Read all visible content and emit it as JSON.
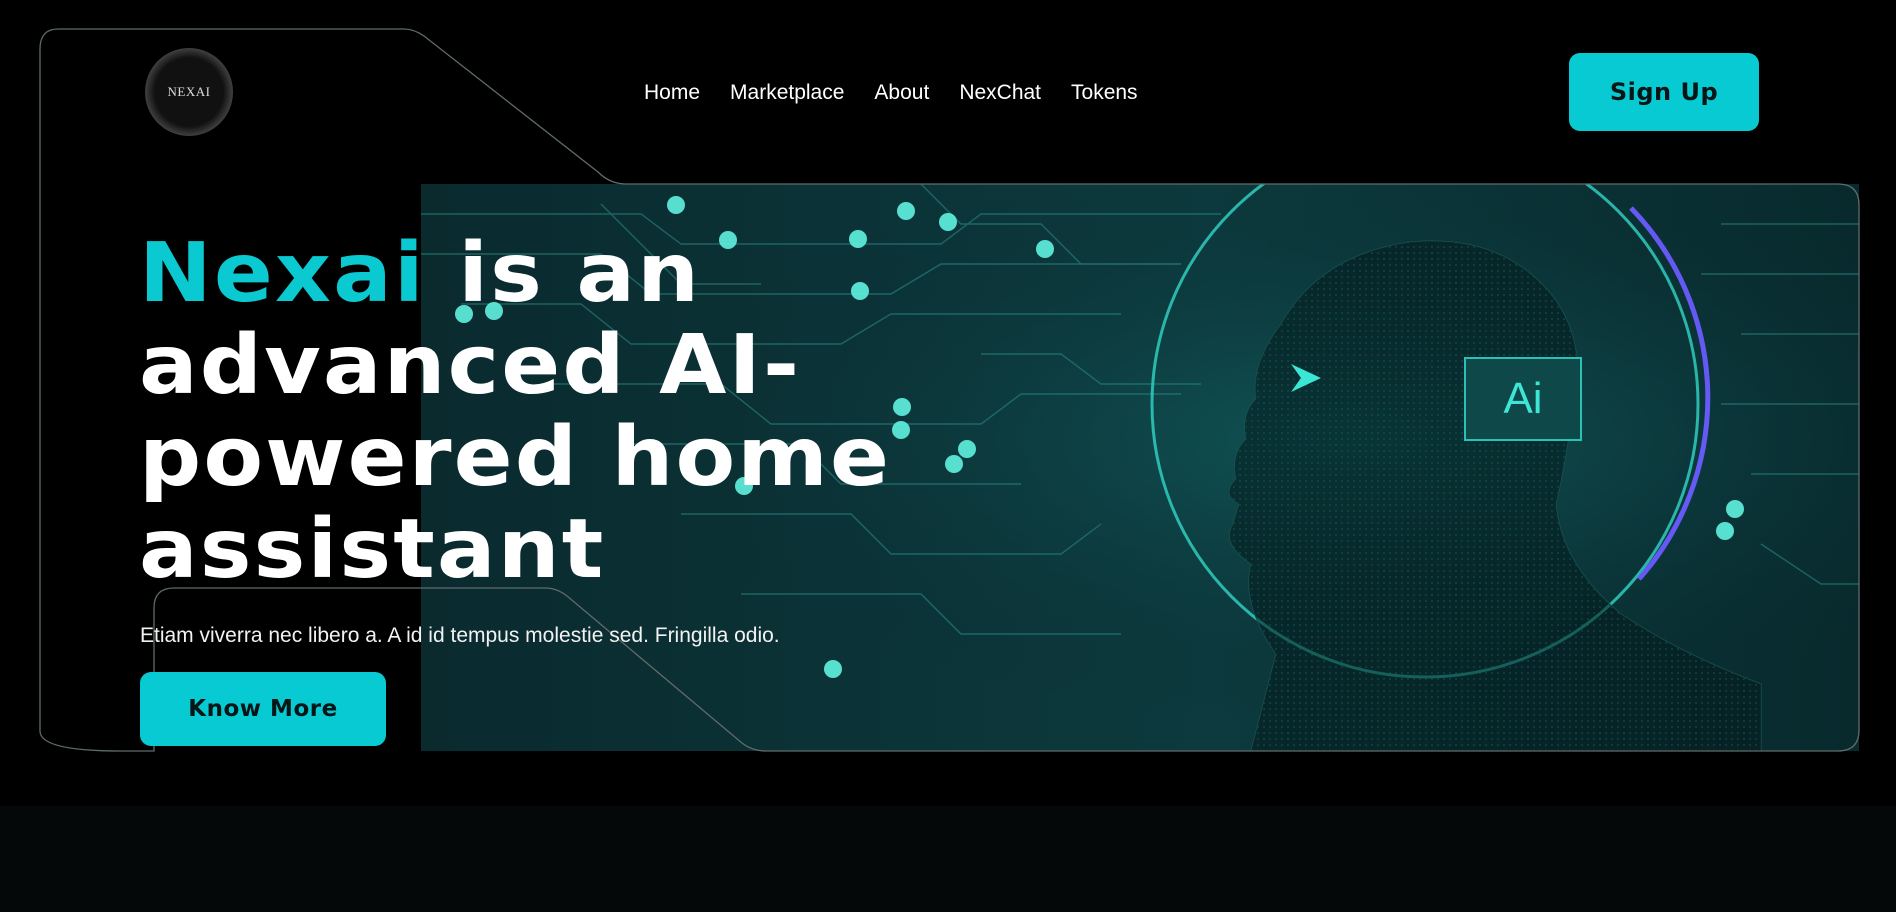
{
  "logo": {
    "text": "NEXAI"
  },
  "nav": {
    "items": [
      "Home",
      "Marketplace",
      "About",
      "NexChat",
      "Tokens"
    ]
  },
  "header": {
    "signup_label": "Sign Up"
  },
  "hero": {
    "title_brand": "Nexai",
    "title_rest_1": " is an",
    "title_line_2": "advanced AI-",
    "title_line_3": "powered home",
    "title_line_4": "assistant",
    "subtitle": "Etiam viverra nec libero a. A id id tempus molestie sed. Fringilla odio.",
    "cta_label": "Know More",
    "image_badge": "Ai"
  },
  "colors": {
    "accent": "#07cad3",
    "background": "#000000",
    "ring_purple": "#6a5cff"
  }
}
